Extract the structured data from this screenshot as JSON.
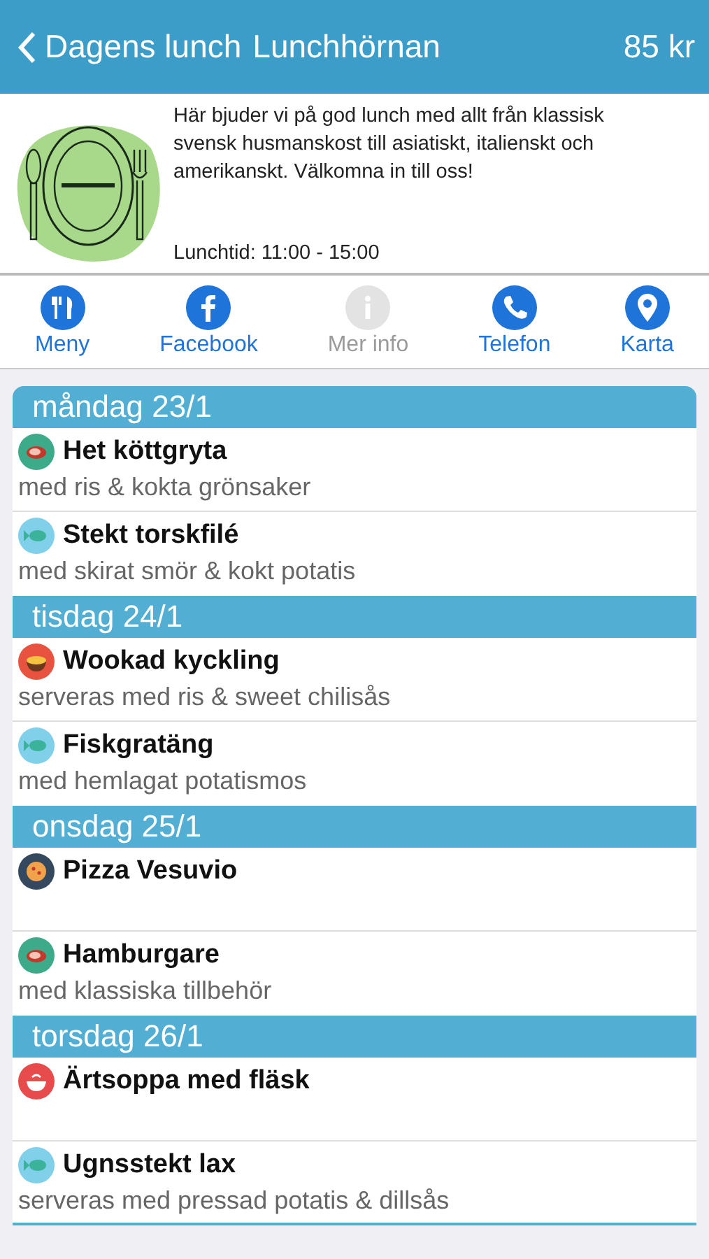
{
  "header": {
    "back_label": "Dagens lunch",
    "title": "Lunchhörnan",
    "price": "85 kr"
  },
  "info": {
    "description": "Här bjuder vi på god lunch med allt från klassisk svensk husmanskost till asiatiskt, italienskt och amerikanskt. Välkomna in till oss!",
    "hours": "Lunchtid: 11:00 - 15:00"
  },
  "actions": [
    {
      "kind": "menu",
      "label": "Meny",
      "disabled": false
    },
    {
      "kind": "facebook",
      "label": "Facebook",
      "disabled": false
    },
    {
      "kind": "info",
      "label": "Mer info",
      "disabled": true
    },
    {
      "kind": "phone",
      "label": "Telefon",
      "disabled": false
    },
    {
      "kind": "map",
      "label": "Karta",
      "disabled": false
    }
  ],
  "days": [
    {
      "title": "måndag 23/1",
      "dishes": [
        {
          "kind": "meat",
          "name": "Het köttgryta",
          "description": "med ris & kokta grönsaker"
        },
        {
          "kind": "fish",
          "name": "Stekt torskfilé",
          "description": "med skirat smör & kokt potatis"
        }
      ]
    },
    {
      "title": "tisdag 24/1",
      "dishes": [
        {
          "kind": "noodles",
          "name": "Wookad kyckling",
          "description": "serveras med ris & sweet chilisås"
        },
        {
          "kind": "fish",
          "name": "Fiskgratäng",
          "description": "med hemlagat potatismos"
        }
      ]
    },
    {
      "title": "onsdag 25/1",
      "dishes": [
        {
          "kind": "pizza",
          "name": "Pizza Vesuvio"
        },
        {
          "kind": "meat",
          "name": "Hamburgare",
          "description": "med klassiska tillbehör"
        }
      ]
    },
    {
      "title": "torsdag 26/1",
      "dishes": [
        {
          "kind": "soup",
          "name": "Ärtsoppa med fläsk"
        },
        {
          "kind": "fish",
          "name": "Ugnsstekt lax",
          "description": "serveras med pressad potatis & dillsås"
        }
      ]
    }
  ]
}
